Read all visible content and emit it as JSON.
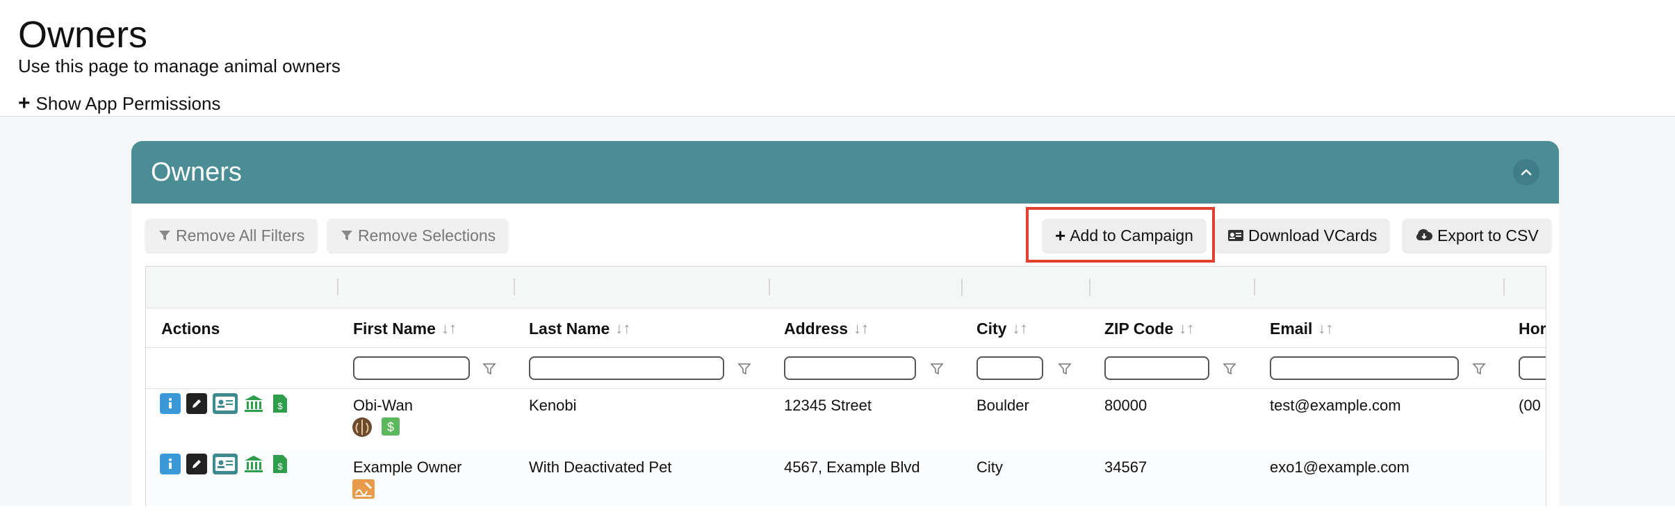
{
  "page": {
    "title": "Owners",
    "subtitle": "Use this page to manage animal owners",
    "permissions_toggle": "Show App Permissions"
  },
  "card": {
    "title": "Owners",
    "collapse_icon": "chevron-up-icon",
    "accent_color": "#4a8d94"
  },
  "toolbar": {
    "remove_filters": "Remove All Filters",
    "remove_selections": "Remove Selections",
    "add_to_campaign": "Add to Campaign",
    "download_vcards": "Download VCards",
    "export_csv": "Export to CSV"
  },
  "table": {
    "columns": [
      "Actions",
      "First Name",
      "Last Name",
      "Address",
      "City",
      "ZIP Code",
      "Email",
      "Hor"
    ],
    "rows": [
      {
        "first_name": "Obi-Wan",
        "last_name": "Kenobi",
        "address": "12345 Street",
        "city": "Boulder",
        "zip": "80000",
        "email": "test@example.com",
        "home": "(00",
        "badges": [
          "jedi-order-icon",
          "dollar-badge-icon"
        ]
      },
      {
        "first_name": "Example Owner",
        "last_name": "With Deactivated Pet",
        "address": "4567, Example Blvd",
        "city": "City",
        "zip": "34567",
        "email": "exo1@example.com",
        "home": "",
        "badges": [
          "signature-icon"
        ]
      }
    ]
  }
}
